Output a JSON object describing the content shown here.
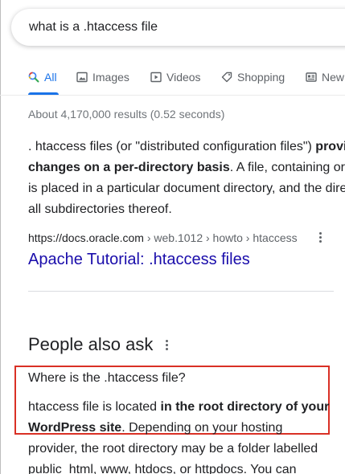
{
  "search": {
    "query": "what is a .htaccess file"
  },
  "tabs": [
    {
      "label": "All",
      "active": true,
      "icon": "search-icon"
    },
    {
      "label": "Images",
      "active": false,
      "icon": "image-icon"
    },
    {
      "label": "Videos",
      "active": false,
      "icon": "play-icon"
    },
    {
      "label": "Shopping",
      "active": false,
      "icon": "tag-icon"
    },
    {
      "label": "New",
      "active": false,
      "icon": "news-icon"
    }
  ],
  "stats": "About 4,170,000 results (0.52 seconds)",
  "snippet": {
    "line1_a": ". htaccess files (or \"distributed configuration files\") ",
    "line1_b": "provi",
    "line2_a": "changes on a per-directory basis",
    "line2_b": ". A file, containing or",
    "line3": "is placed in a particular document directory, and the dire",
    "line4": "all subdirectories thereof."
  },
  "result": {
    "cite_domain": "https://docs.oracle.com",
    "cite_crumbs": " › web.1012 › howto › htaccess",
    "title": "Apache Tutorial: .htaccess files"
  },
  "paa": {
    "title": "People also ask",
    "question": "Where is the .htaccess file?",
    "answer_line1_a": "htaccess file is located ",
    "answer_line1_b": "in the root directory of your",
    "answer_line2_a": "WordPress site",
    "answer_line2_b": ". Depending on your hosting",
    "answer_line3": "provider, the root directory may be a folder labelled",
    "answer_line4": "public_html, www, htdocs, or httpdocs. You can"
  },
  "colors": {
    "accent": "#1a73e8",
    "link": "#1a0dab",
    "highlight_box": "#d93025"
  }
}
